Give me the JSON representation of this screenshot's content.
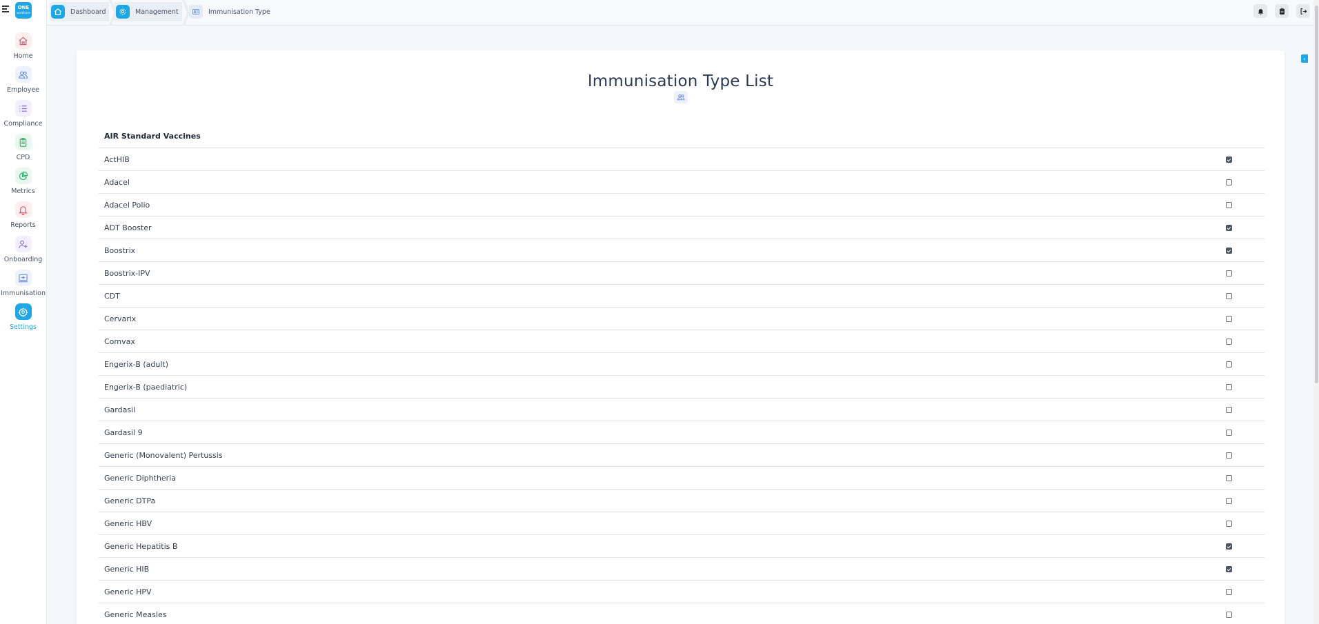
{
  "app": {
    "logo_text": "ONE",
    "logo_subtext": "workforce"
  },
  "sidebar": {
    "items": [
      {
        "label": "Home",
        "icon": "home-icon",
        "color": "#e0566b"
      },
      {
        "label": "Employee",
        "icon": "users-icon",
        "color": "#6a8fe8"
      },
      {
        "label": "Compliance",
        "icon": "list-icon",
        "color": "#8b6fe6"
      },
      {
        "label": "CPD",
        "icon": "clipboard-icon",
        "color": "#2fb36a"
      },
      {
        "label": "Metrics",
        "icon": "pie-chart-icon",
        "color": "#2fb36a"
      },
      {
        "label": "Reports",
        "icon": "bell-icon",
        "color": "#e0566b"
      },
      {
        "label": "Onboarding",
        "icon": "user-plus-icon",
        "color": "#8b6fe6"
      },
      {
        "label": "Immunisation",
        "icon": "monitor-plus-icon",
        "color": "#6a8fe8"
      },
      {
        "label": "Settings",
        "icon": "gear-icon",
        "color": "#1ea7e4",
        "active": true
      }
    ]
  },
  "breadcrumb": {
    "items": [
      "Dashboard",
      "Management",
      "Immunisation Type"
    ]
  },
  "topbar_actions": [
    "bell-icon",
    "clipboard-icon",
    "logout-icon"
  ],
  "page": {
    "title": "Immunisation Type List",
    "section_title": "AIR Standard Vaccines"
  },
  "vaccines": [
    {
      "name": "ActHIB",
      "checked": true
    },
    {
      "name": "Adacel",
      "checked": false
    },
    {
      "name": "Adacel Polio",
      "checked": false
    },
    {
      "name": "ADT Booster",
      "checked": true
    },
    {
      "name": "Boostrix",
      "checked": true
    },
    {
      "name": "Boostrix-IPV",
      "checked": false
    },
    {
      "name": "CDT",
      "checked": false
    },
    {
      "name": "Cervarix",
      "checked": false
    },
    {
      "name": "Comvax",
      "checked": false
    },
    {
      "name": "Engerix-B (adult)",
      "checked": false
    },
    {
      "name": "Engerix-B (paediatric)",
      "checked": false
    },
    {
      "name": "Gardasil",
      "checked": false
    },
    {
      "name": "Gardasil 9",
      "checked": false
    },
    {
      "name": "Generic (Monovalent) Pertussis",
      "checked": false
    },
    {
      "name": "Generic Diphtheria",
      "checked": false
    },
    {
      "name": "Generic DTPa",
      "checked": false
    },
    {
      "name": "Generic HBV",
      "checked": false
    },
    {
      "name": "Generic Hepatitis B",
      "checked": true
    },
    {
      "name": "Generic HIB",
      "checked": true
    },
    {
      "name": "Generic HPV",
      "checked": false
    },
    {
      "name": "Generic Measles",
      "checked": false
    }
  ]
}
